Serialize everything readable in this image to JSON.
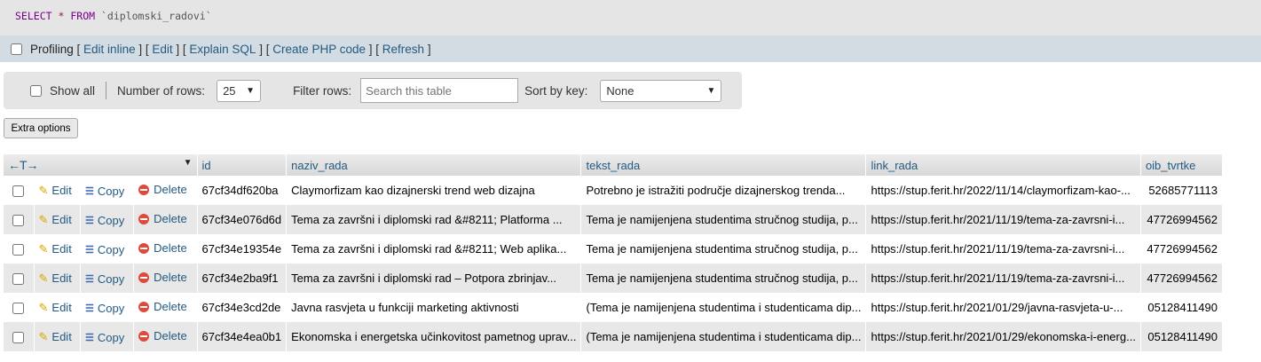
{
  "sql": {
    "keyword_select": "SELECT",
    "star": "*",
    "keyword_from": "FROM",
    "table": "`diplomski_radovi`"
  },
  "profiling": {
    "label": "Profiling",
    "links": [
      "Edit inline",
      "Edit",
      "Explain SQL",
      "Create PHP code",
      "Refresh"
    ]
  },
  "nav": {
    "show_all": "Show all",
    "number_of_rows_label": "Number of rows:",
    "number_of_rows_value": "25",
    "filter_label": "Filter rows:",
    "filter_placeholder": "Search this table",
    "sort_label": "Sort by key:",
    "sort_value": "None"
  },
  "extra_options": "Extra options",
  "table": {
    "columns": [
      "id",
      "naziv_rada",
      "tekst_rada",
      "link_rada",
      "oib_tvrtke"
    ],
    "actions": {
      "edit": "Edit",
      "copy": "Copy",
      "delete": "Delete"
    },
    "rows": [
      [
        "67cf34df620ba",
        "Claymorfizam kao dizajnerski trend web dizajna",
        "Potrebno je istražiti područje dizajnerskog trenda...",
        "https://stup.ferit.hr/2022/11/14/claymorfizam-kao-...",
        "52685771113"
      ],
      [
        "67cf34e076d6d",
        "Tema za završni i diplomski rad &#8211; Platforma ...",
        "Tema je namijenjena studentima stručnog studija, p...",
        "https://stup.ferit.hr/2021/11/19/tema-za-zavrsni-i...",
        "47726994562"
      ],
      [
        "67cf34e19354e",
        "Tema za završni i diplomski rad &#8211; Web aplika...",
        "Tema je namijenjena studentima stručnog studija, p...",
        "https://stup.ferit.hr/2021/11/19/tema-za-zavrsni-i...",
        "47726994562"
      ],
      [
        "67cf34e2ba9f1",
        "Tema za završni i diplomski rad – Potpora zbrinjav...",
        "Tema je namijenjena studentima stručnog studija, p...",
        "https://stup.ferit.hr/2021/11/19/tema-za-zavrsni-i...",
        "47726994562"
      ],
      [
        "67cf34e3cd2de",
        "Javna rasvjeta u funkciji marketing aktivnosti",
        "(Tema je namijenjena studentima i studenticama dip...",
        "https://stup.ferit.hr/2021/01/29/javna-rasvjeta-u-...",
        "05128411490"
      ],
      [
        "67cf34e4ea0b1",
        "Ekonomska i energetska učinkovitost pametnog uprav...",
        "(Tema je namijenjena studentima i studenticama dip...",
        "https://stup.ferit.hr/2021/01/29/ekonomska-i-energ...",
        "05128411490"
      ]
    ]
  }
}
